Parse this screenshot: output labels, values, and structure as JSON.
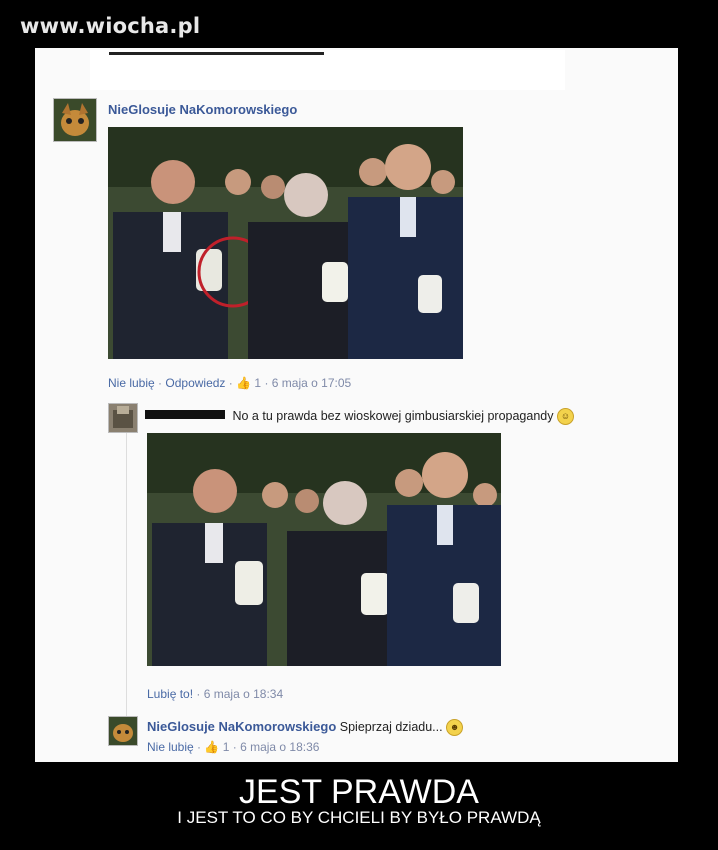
{
  "watermark": "www.wiocha.pl",
  "post": {
    "author": "NieGlosuje NaKomorowskiego",
    "actions": {
      "unlike": "Nie lubię",
      "reply": "Odpowiedz",
      "likes": "1",
      "timestamp": "6 maja o 17:05"
    }
  },
  "reply1": {
    "text": "No a tu prawda bez wioskowej gimbusiarskiej propagandy",
    "like_label": "Lubię to!",
    "timestamp": "6 maja o 18:34"
  },
  "reply2": {
    "author": "NieGlosuje NaKomorowskiego",
    "text": "Spieprzaj dziadu...",
    "unlike": "Nie lubię",
    "likes": "1",
    "timestamp": "6 maja o 18:36"
  },
  "caption": {
    "title": "JEST PRAWDA",
    "subtitle": "I JEST TO CO BY CHCIELI BY BYŁO PRAWDĄ"
  },
  "colors": {
    "link_blue": "#3b5998",
    "meta_gray": "#7f8aa8",
    "highlight_circle": "#c0202a"
  },
  "icons": [
    "thumbs-up-icon",
    "smiley-emoji-icon",
    "grimace-emoji-icon"
  ]
}
